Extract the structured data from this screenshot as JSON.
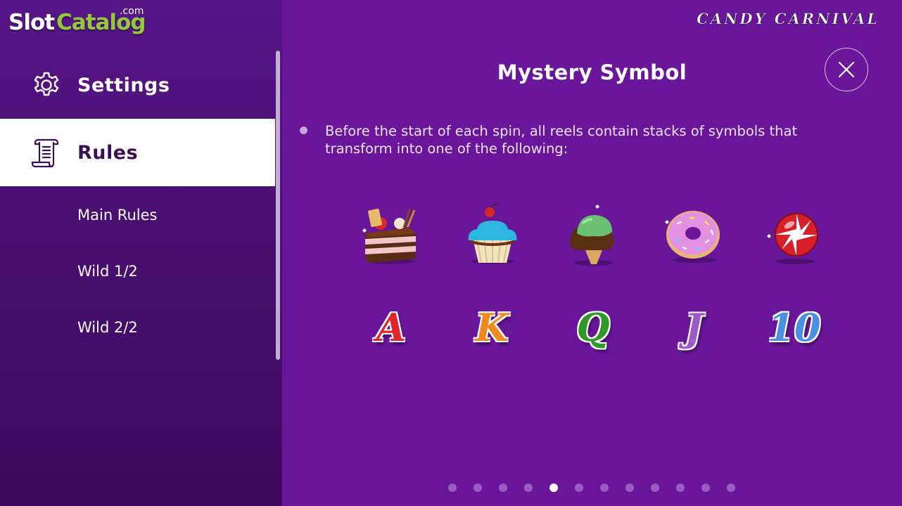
{
  "logo": {
    "slot": "Slot",
    "catalog": "Catalog",
    "com": ".com"
  },
  "sidebar": {
    "settings_label": "Settings",
    "rules_label": "Rules",
    "sub_items": [
      "Main Rules",
      "Wild 1/2",
      "Wild 2/2"
    ]
  },
  "main": {
    "game_title": "CANDY CARNIVAL",
    "page_title": "Mystery Symbol",
    "description": "Before the start of each spin, all reels contain stacks of symbols that transform into one of the following:",
    "letters": [
      "A",
      "K",
      "Q",
      "J",
      "10"
    ],
    "candy_symbols": [
      "cake-icon",
      "cupcake-icon",
      "ice-cream-icon",
      "donut-icon",
      "candy-icon"
    ]
  },
  "pagination": {
    "total": 12,
    "active_index": 4
  },
  "colors": {
    "sidebar_bg": "#4a0f72",
    "main_bg": "#6a169a",
    "selected_bg": "#ffffff",
    "accent_green": "#93c83e",
    "letter_A": "#e0262c",
    "letter_K": "#f08a1e",
    "letter_Q": "#2f9a2a",
    "letter_J": "#9b59c9",
    "letter_10": "#4a90e2"
  }
}
